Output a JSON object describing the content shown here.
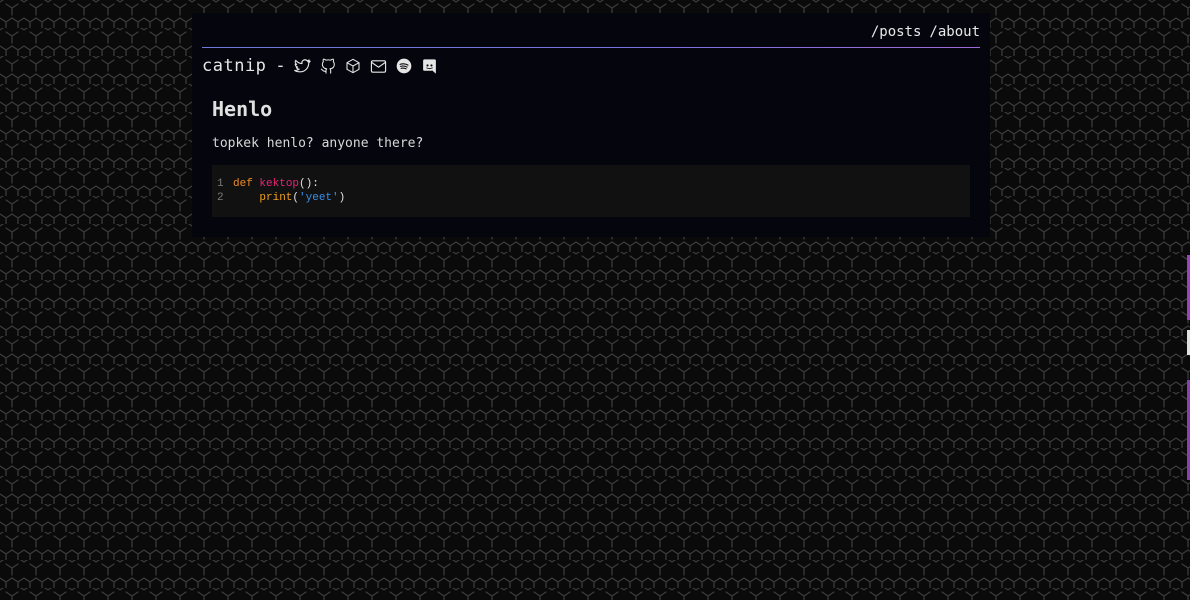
{
  "nav": {
    "links": [
      "/posts",
      "/about"
    ]
  },
  "header": {
    "site_name": "catnip",
    "separator": "-",
    "icons": [
      "twitter-icon",
      "github-icon",
      "package-icon",
      "mail-icon",
      "spotify-icon",
      "discord-icon"
    ]
  },
  "post": {
    "title": "Henlo",
    "body": "topkek henlo? anyone there?",
    "code": {
      "lines": [
        {
          "num": "1",
          "keyword": "def",
          "func": "kektop",
          "punct": "():"
        },
        {
          "num": "2",
          "indent": "    ",
          "builtin": "print",
          "open": "(",
          "string": "'yeet'",
          "close": ")"
        }
      ]
    }
  },
  "colors": {
    "background": "#0a0a0a",
    "panel": "#05050d",
    "divider": "#6a7ad8",
    "code_bg": "#111111",
    "keyword": "#f08a24",
    "function": "#e8247a",
    "string": "#3a8ee8"
  }
}
